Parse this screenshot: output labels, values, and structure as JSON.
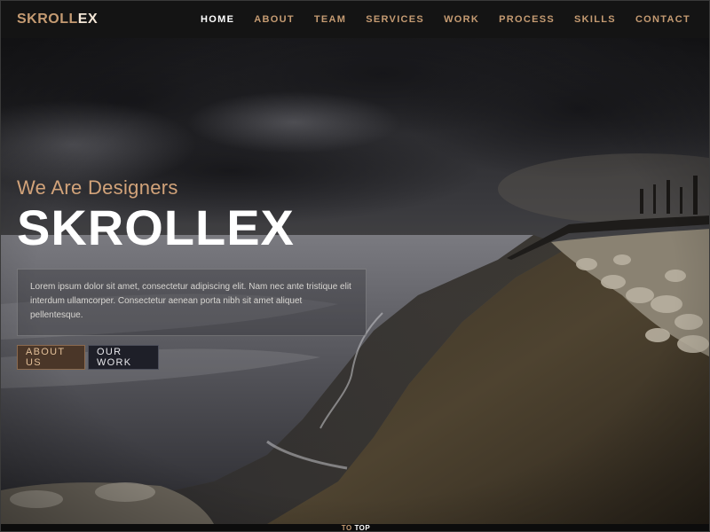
{
  "brand": {
    "part1": "SKROLL",
    "part2": "EX"
  },
  "nav": {
    "items": [
      {
        "label": "HOME",
        "active": true
      },
      {
        "label": "ABOUT"
      },
      {
        "label": "TEAM"
      },
      {
        "label": "SERVICES"
      },
      {
        "label": "WORK"
      },
      {
        "label": "PROCESS"
      },
      {
        "label": "SKILLS"
      },
      {
        "label": "CONTACT"
      }
    ]
  },
  "hero": {
    "subtitle": "We Are Designers",
    "title": "SKROLLEX",
    "description": "Lorem ipsum dolor sit amet, consectetur adipiscing elit. Nam nec ante tristique elit interdum ullamcorper. Consectetur aenean porta nibh sit amet aliquet pellentesque.",
    "buttons": {
      "about": "ABOUT US",
      "work": "OUR WORK"
    }
  },
  "footer": {
    "to": "TO",
    "top": "TOP"
  },
  "colors": {
    "accent": "#c59b72",
    "navbar": "#141414",
    "white": "#ffffff"
  }
}
